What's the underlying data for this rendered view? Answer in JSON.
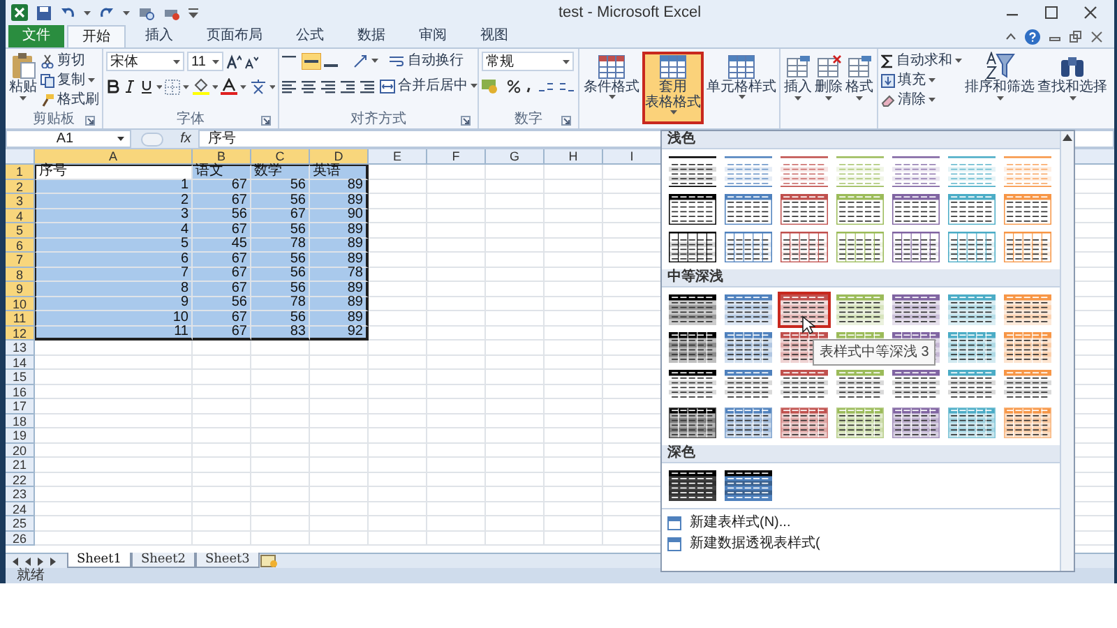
{
  "window": {
    "title": "test - Microsoft Excel"
  },
  "tabs": [
    {
      "label": "文件",
      "kind": "file",
      "selected": false
    },
    {
      "label": "开始",
      "kind": "tab",
      "selected": true
    },
    {
      "label": "插入",
      "kind": "tab",
      "selected": false
    },
    {
      "label": "页面布局",
      "kind": "tab",
      "selected": false
    },
    {
      "label": "公式",
      "kind": "tab",
      "selected": false
    },
    {
      "label": "数据",
      "kind": "tab",
      "selected": false
    },
    {
      "label": "审阅",
      "kind": "tab",
      "selected": false
    },
    {
      "label": "视图",
      "kind": "tab",
      "selected": false
    }
  ],
  "ribbon": {
    "clipboard": {
      "label": "剪贴板",
      "paste": "粘贴",
      "cut": "剪切",
      "copy": "复制",
      "format_painter": "格式刷"
    },
    "font": {
      "label": "字体",
      "font_name": "宋体",
      "font_size": "11"
    },
    "alignment": {
      "label": "对齐方式",
      "wrap_text": "自动换行",
      "merge_center": "合并后居中"
    },
    "number": {
      "label": "数字",
      "format": "常规"
    },
    "styles": {
      "buttons": [
        {
          "lines": [
            "条件格式"
          ],
          "selected": false
        },
        {
          "lines": [
            "套用",
            "表格格式"
          ],
          "selected": true
        },
        {
          "lines": [
            "单元格样式"
          ],
          "selected": false
        }
      ]
    },
    "cells": {
      "buttons": [
        "插入",
        "删除",
        "格式"
      ]
    },
    "editing": {
      "autosum": "自动求和",
      "fill": "填充",
      "clear": "清除",
      "sort_filter": "排序和筛选",
      "find_select": "查找和选择"
    }
  },
  "formula_bar": {
    "name_box": "A1",
    "fx": "fx",
    "content": "序号"
  },
  "sheet": {
    "columns": [
      {
        "label": "A",
        "selected": true
      },
      {
        "label": "B",
        "selected": true
      },
      {
        "label": "C",
        "selected": true
      },
      {
        "label": "D",
        "selected": true
      },
      {
        "label": "E",
        "selected": false
      },
      {
        "label": "F",
        "selected": false
      },
      {
        "label": "G",
        "selected": false
      },
      {
        "label": "H",
        "selected": false
      },
      {
        "label": "I",
        "selected": false
      }
    ],
    "rows": [
      {
        "label": "1",
        "selected": true,
        "kind": "text",
        "cells": [
          {
            "text": "序号",
            "active": true
          },
          {
            "text": "语文",
            "active": false
          },
          {
            "text": "数学",
            "active": false
          },
          {
            "text": "英语",
            "active": false
          }
        ]
      },
      {
        "label": "2",
        "selected": true,
        "kind": "number",
        "cells": [
          {
            "text": "1",
            "active": false
          },
          {
            "text": "67",
            "active": false
          },
          {
            "text": "56",
            "active": false
          },
          {
            "text": "89",
            "active": false
          }
        ]
      },
      {
        "label": "3",
        "selected": true,
        "kind": "number",
        "cells": [
          {
            "text": "2",
            "active": false
          },
          {
            "text": "67",
            "active": false
          },
          {
            "text": "56",
            "active": false
          },
          {
            "text": "89",
            "active": false
          }
        ]
      },
      {
        "label": "4",
        "selected": true,
        "kind": "number",
        "cells": [
          {
            "text": "3",
            "active": false
          },
          {
            "text": "56",
            "active": false
          },
          {
            "text": "67",
            "active": false
          },
          {
            "text": "90",
            "active": false
          }
        ]
      },
      {
        "label": "5",
        "selected": true,
        "kind": "number",
        "cells": [
          {
            "text": "4",
            "active": false
          },
          {
            "text": "67",
            "active": false
          },
          {
            "text": "56",
            "active": false
          },
          {
            "text": "89",
            "active": false
          }
        ]
      },
      {
        "label": "6",
        "selected": true,
        "kind": "number",
        "cells": [
          {
            "text": "5",
            "active": false
          },
          {
            "text": "45",
            "active": false
          },
          {
            "text": "78",
            "active": false
          },
          {
            "text": "89",
            "active": false
          }
        ]
      },
      {
        "label": "7",
        "selected": true,
        "kind": "number",
        "cells": [
          {
            "text": "6",
            "active": false
          },
          {
            "text": "67",
            "active": false
          },
          {
            "text": "56",
            "active": false
          },
          {
            "text": "89",
            "active": false
          }
        ]
      },
      {
        "label": "8",
        "selected": true,
        "kind": "number",
        "cells": [
          {
            "text": "7",
            "active": false
          },
          {
            "text": "67",
            "active": false
          },
          {
            "text": "56",
            "active": false
          },
          {
            "text": "78",
            "active": false
          }
        ]
      },
      {
        "label": "9",
        "selected": true,
        "kind": "number",
        "cells": [
          {
            "text": "8",
            "active": false
          },
          {
            "text": "67",
            "active": false
          },
          {
            "text": "56",
            "active": false
          },
          {
            "text": "89",
            "active": false
          }
        ]
      },
      {
        "label": "10",
        "selected": true,
        "kind": "number",
        "cells": [
          {
            "text": "9",
            "active": false
          },
          {
            "text": "56",
            "active": false
          },
          {
            "text": "78",
            "active": false
          },
          {
            "text": "89",
            "active": false
          }
        ]
      },
      {
        "label": "11",
        "selected": true,
        "kind": "number",
        "cells": [
          {
            "text": "10",
            "active": false
          },
          {
            "text": "67",
            "active": false
          },
          {
            "text": "56",
            "active": false
          },
          {
            "text": "89",
            "active": false
          }
        ]
      },
      {
        "label": "12",
        "selected": true,
        "kind": "number",
        "cells": [
          {
            "text": "11",
            "active": false
          },
          {
            "text": "67",
            "active": false
          },
          {
            "text": "83",
            "active": false
          },
          {
            "text": "92",
            "active": false
          }
        ]
      },
      {
        "label": "13",
        "selected": false,
        "kind": "number"
      },
      {
        "label": "14",
        "selected": false,
        "kind": "number"
      },
      {
        "label": "15",
        "selected": false,
        "kind": "number"
      },
      {
        "label": "16",
        "selected": false,
        "kind": "number"
      },
      {
        "label": "17",
        "selected": false,
        "kind": "number"
      },
      {
        "label": "18",
        "selected": false,
        "kind": "number"
      },
      {
        "label": "19",
        "selected": false,
        "kind": "number"
      },
      {
        "label": "20",
        "selected": false,
        "kind": "number"
      },
      {
        "label": "21",
        "selected": false,
        "kind": "number"
      },
      {
        "label": "22",
        "selected": false,
        "kind": "number"
      },
      {
        "label": "23",
        "selected": false,
        "kind": "number"
      },
      {
        "label": "24",
        "selected": false,
        "kind": "number"
      },
      {
        "label": "25",
        "selected": false,
        "kind": "number"
      },
      {
        "label": "26",
        "selected": false,
        "kind": "number"
      }
    ],
    "sheet_tabs": [
      {
        "label": "Sheet1",
        "selected": true
      },
      {
        "label": "Sheet2",
        "selected": false
      },
      {
        "label": "Sheet3",
        "selected": false
      }
    ]
  },
  "status_bar": {
    "text": "就绪"
  },
  "gallery": {
    "sections": [
      {
        "label": "浅色",
        "rows": [
          {
            "kind": "light-lines",
            "styles": [
              {
                "color": "#000000",
                "selected": false
              },
              {
                "color": "#4f81bd",
                "selected": false
              },
              {
                "color": "#c0504d",
                "selected": false
              },
              {
                "color": "#9bbb59",
                "selected": false
              },
              {
                "color": "#8064a2",
                "selected": false
              },
              {
                "color": "#4bacc6",
                "selected": false
              },
              {
                "color": "#f79646",
                "selected": false
              }
            ]
          },
          {
            "kind": "light-header",
            "styles": [
              {
                "color": "#000000",
                "selected": false
              },
              {
                "color": "#4f81bd",
                "selected": false
              },
              {
                "color": "#c0504d",
                "selected": false
              },
              {
                "color": "#9bbb59",
                "selected": false
              },
              {
                "color": "#8064a2",
                "selected": false
              },
              {
                "color": "#4bacc6",
                "selected": false
              },
              {
                "color": "#f79646",
                "selected": false
              }
            ]
          },
          {
            "kind": "light-grid",
            "styles": [
              {
                "color": "#000000",
                "selected": false
              },
              {
                "color": "#4f81bd",
                "selected": false
              },
              {
                "color": "#c0504d",
                "selected": false
              },
              {
                "color": "#9bbb59",
                "selected": false
              },
              {
                "color": "#8064a2",
                "selected": false
              },
              {
                "color": "#4bacc6",
                "selected": false
              },
              {
                "color": "#f79646",
                "selected": false
              }
            ]
          }
        ]
      },
      {
        "label": "中等深浅",
        "rows": [
          {
            "kind": "medium-header",
            "styles": [
              {
                "color": "#000000",
                "selected": false
              },
              {
                "color": "#4f81bd",
                "selected": false
              },
              {
                "color": "#c0504d",
                "selected": true
              },
              {
                "color": "#9bbb59",
                "selected": false
              },
              {
                "color": "#8064a2",
                "selected": false
              },
              {
                "color": "#4bacc6",
                "selected": false
              },
              {
                "color": "#f79646",
                "selected": false
              }
            ]
          },
          {
            "kind": "medium-banded",
            "styles": [
              {
                "color": "#000000",
                "selected": false
              },
              {
                "color": "#4f81bd",
                "selected": false
              },
              {
                "color": "#c0504d",
                "selected": false
              },
              {
                "color": "#9bbb59",
                "selected": false
              },
              {
                "color": "#8064a2",
                "selected": false
              },
              {
                "color": "#4bacc6",
                "selected": false
              },
              {
                "color": "#f79646",
                "selected": false
              }
            ]
          },
          {
            "kind": "medium-gray",
            "styles": [
              {
                "color": "#000000",
                "selected": false
              },
              {
                "color": "#4f81bd",
                "selected": false
              },
              {
                "color": "#c0504d",
                "selected": false
              },
              {
                "color": "#9bbb59",
                "selected": false
              },
              {
                "color": "#8064a2",
                "selected": false
              },
              {
                "color": "#4bacc6",
                "selected": false
              },
              {
                "color": "#f79646",
                "selected": false
              }
            ]
          },
          {
            "kind": "medium-tint",
            "styles": [
              {
                "color": "#000000",
                "selected": false
              },
              {
                "color": "#4f81bd",
                "selected": false
              },
              {
                "color": "#c0504d",
                "selected": false
              },
              {
                "color": "#9bbb59",
                "selected": false
              },
              {
                "color": "#8064a2",
                "selected": false
              },
              {
                "color": "#4bacc6",
                "selected": false
              },
              {
                "color": "#f79646",
                "selected": false
              }
            ]
          }
        ]
      },
      {
        "label": "深色",
        "rows": [
          {
            "kind": "dark",
            "styles": [
              {
                "color": "#404040",
                "selected": false
              },
              {
                "color": "#4f81bd",
                "selected": false
              }
            ]
          }
        ]
      }
    ],
    "menu": [
      {
        "label": "新建表样式(N)..."
      },
      {
        "label": "新建数据透视表样式("
      }
    ],
    "tooltip": "表样式中等深浅 3"
  }
}
